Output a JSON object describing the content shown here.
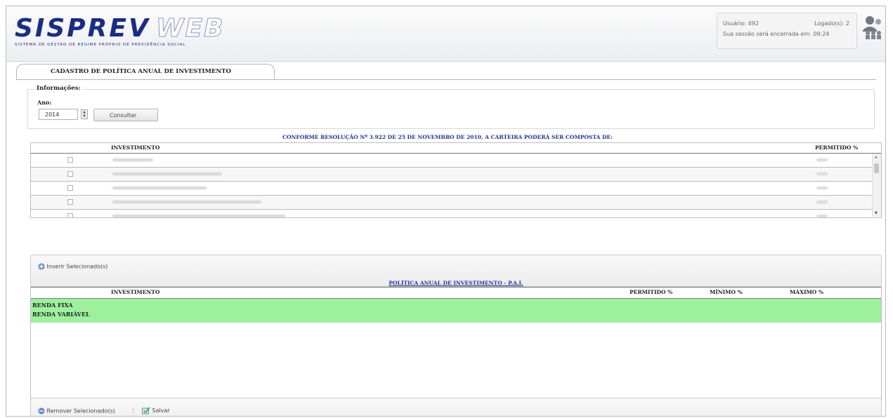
{
  "header": {
    "logo_main": "SISPREV",
    "logo_web": "WEB",
    "logo_subtitle": "SISTEMA DE GESTÃO DE REGIME PRÓPRIO DE PREVIDÊNCIA SOCIAL",
    "user_label": "Usuário: 492",
    "logged_label": "Logado(s): 2",
    "session_text": "Sua sessão será encerrada em: 09:24"
  },
  "page": {
    "title": "CADASTRO DE POLÍTICA ANUAL DE INVESTIMENTO"
  },
  "filter": {
    "legend": "Informações:",
    "year_label": "Ano:",
    "year_value": "2014",
    "consult_button": "Consultar"
  },
  "section1": {
    "title": "CONFORME RESOLUÇÃO Nº 3.922 DE 25 DE NOVEMBRO DE 2010, A CARTEIRA PODERÁ SER COMPOSTA DE:",
    "col_investimento": "INVESTIMENTO",
    "col_permitido": "PERMITIDO %",
    "row_count_visible": 5
  },
  "toolbar1": {
    "insert_label": "Inserir Selecionado(s)"
  },
  "section2": {
    "title": "POLÍTICA ANUAL DE INVESTIMENTO - P.A.I.",
    "col_investimento": "INVESTIMENTO",
    "col_permitido": "PERMITIDO %",
    "col_minimo": "MÍNIMO %",
    "col_maximo": "MÁXIMO %",
    "rows": [
      "RENDA FIXA",
      "RENDA VARIÁVEL"
    ]
  },
  "toolbar2": {
    "remove_label": "Remover Selecionado(s)",
    "separator": "|",
    "save_label": "Salvar"
  },
  "colors": {
    "logo_blue": "#1a2d86",
    "section_title_blue": "#2233aa",
    "highlight_green": "#9df19d"
  }
}
